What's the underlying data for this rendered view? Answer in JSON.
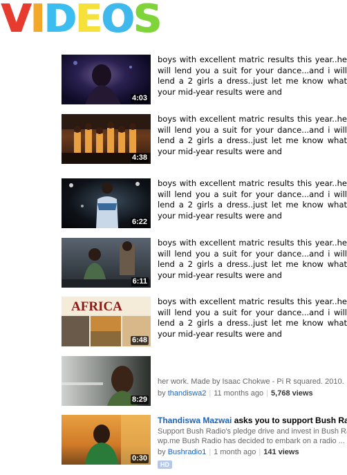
{
  "page": {
    "title_letters": [
      {
        "ch": "V",
        "color": "#e63b2e"
      },
      {
        "ch": "I",
        "color": "#f4a82a"
      },
      {
        "ch": "D",
        "color": "#3bbdf0"
      },
      {
        "ch": "E",
        "color": "#f6e03a"
      },
      {
        "ch": "O",
        "color": "#3fb8ec"
      },
      {
        "ch": "S",
        "color": "#7fd43a"
      }
    ]
  },
  "videos": [
    {
      "duration": "4:03",
      "description": "boys with excellent matric results this year..he will lend you a suit for your dance...and i will lend a 2 girls a dress..just let me know what your mid-year results were and"
    },
    {
      "duration": "4:38",
      "description": "boys with excellent matric results this year..he will lend you a suit for your dance...and i will lend a 2 girls a dress..just let me know what your mid-year results were and"
    },
    {
      "duration": "6:22",
      "description": "boys with excellent matric results this year..he will lend you a suit for your dance...and i will lend a 2 girls a dress..just let me know what your mid-year results were and"
    },
    {
      "duration": "6:11",
      "description": "boys with excellent matric results this year..he will lend you a suit for your dance...and i will lend a 2 girls a dress..just let me know what your mid-year results were and"
    },
    {
      "duration": "6:48",
      "thumb_text": "AFRICA",
      "description": "boys with excellent matric results this year..he will lend you a suit for your dance...and i will lend a 2 girls a dress..just let me know what your mid-year results were and"
    }
  ],
  "video6": {
    "duration": "8:29",
    "description": "her work. Made by Isaac Chokwe - Pi R squared. 2010.",
    "by_label": "by",
    "channel": "thandiswa2",
    "age": "11 months ago",
    "views": "5,768 views"
  },
  "video7": {
    "duration": "0:30",
    "title_link": "Thandiswa Mazwai",
    "title_rest": "asks you to support Bush Radio",
    "desc_line1": "Support Bush Radio's pledge drive and invest in Bush Radio,",
    "desc_line2": "wp.me Bush Radio has decided to embark on a radio ...",
    "by_label": "by",
    "channel": "Bushradio1",
    "age": "1 month ago",
    "views": "141 views",
    "badge": "HD"
  }
}
